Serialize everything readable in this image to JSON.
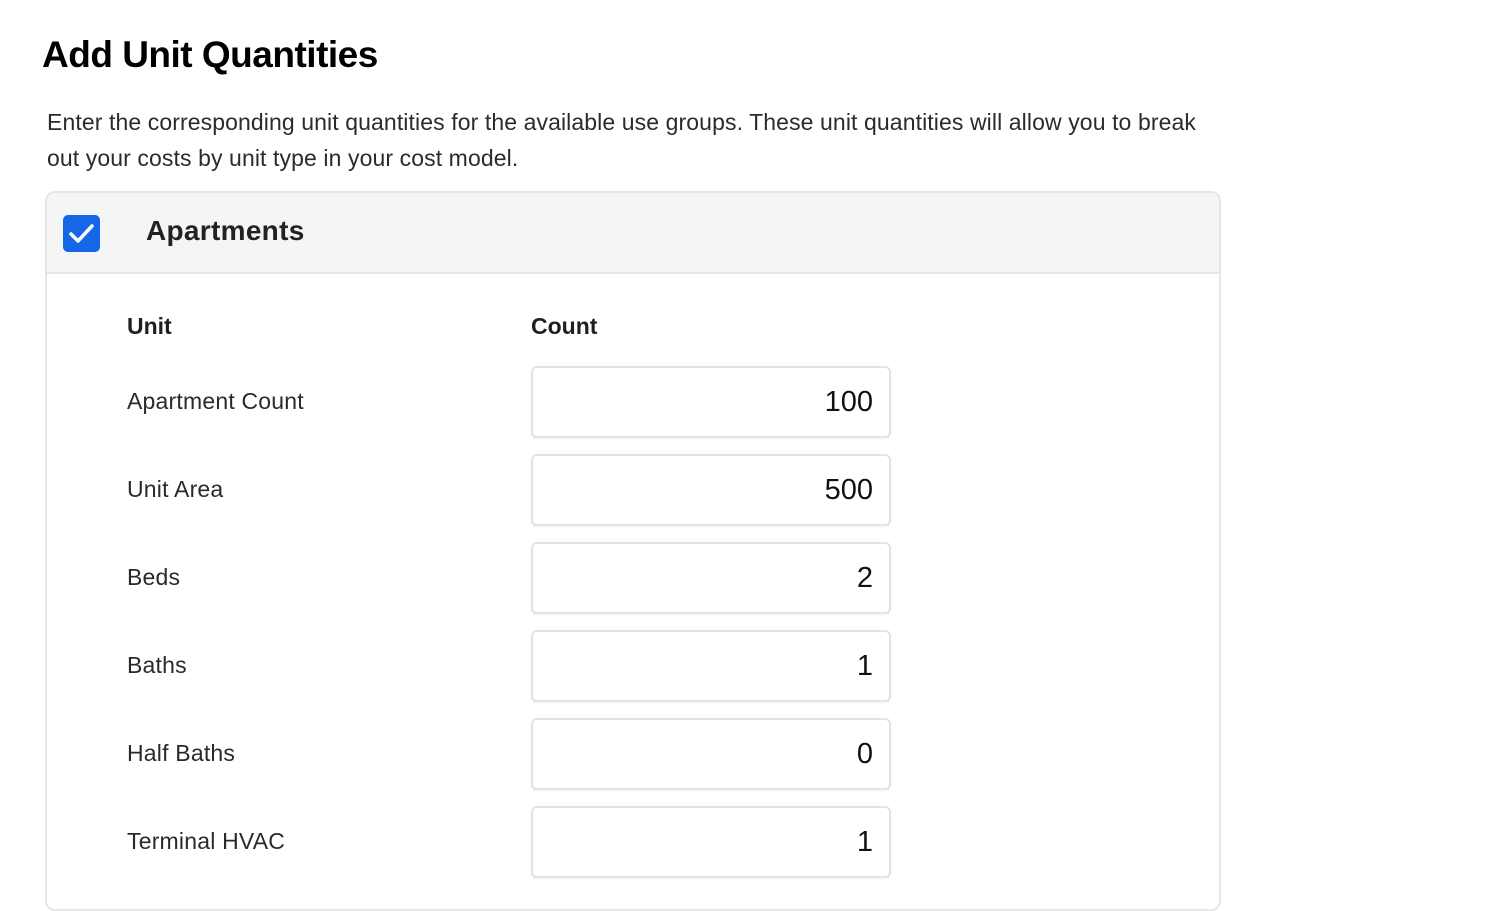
{
  "page": {
    "title": "Add Unit Quantities",
    "description": "Enter the corresponding unit quantities for the available use groups. These unit quantities will allow you to break out your costs by unit type in your cost model."
  },
  "group": {
    "name": "Apartments",
    "checked": true,
    "checkbox_color": "#1667e8",
    "columns": {
      "unit": "Unit",
      "count": "Count"
    },
    "rows": [
      {
        "label": "Apartment Count",
        "value": "100"
      },
      {
        "label": "Unit Area",
        "value": "500"
      },
      {
        "label": "Beds",
        "value": "2"
      },
      {
        "label": "Baths",
        "value": "1"
      },
      {
        "label": "Half Baths",
        "value": "0"
      },
      {
        "label": "Terminal HVAC",
        "value": "1"
      }
    ]
  },
  "icons": {
    "checkbox": "checkmark-icon"
  }
}
